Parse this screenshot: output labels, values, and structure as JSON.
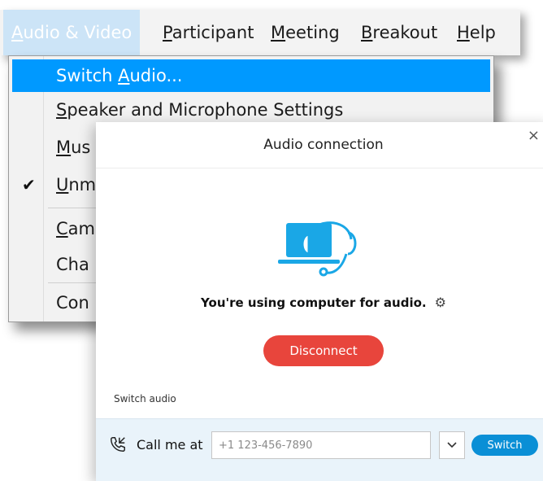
{
  "menubar": {
    "items": [
      {
        "label": "Audio & Video",
        "mnemonic": "A",
        "rest": "udio & Video"
      },
      {
        "label": "Participant",
        "mnemonic": "P",
        "rest": "articipant"
      },
      {
        "label": "Meeting",
        "mnemonic": "M",
        "rest": "eeting"
      },
      {
        "label": "Breakout",
        "mnemonic": "B",
        "rest": "reakout"
      },
      {
        "label": "Help",
        "mnemonic": "H",
        "rest": "elp"
      }
    ]
  },
  "dropdown": {
    "items": [
      {
        "pre": "Switch ",
        "mnemonic": "A",
        "post": "udio..."
      },
      {
        "pre": "",
        "mnemonic": "S",
        "post": "peaker and Microphone Settings"
      },
      {
        "pre": "",
        "mnemonic": "M",
        "post": "us"
      },
      {
        "pre": "",
        "mnemonic": "U",
        "post": "nm"
      },
      {
        "pre": "",
        "mnemonic": "C",
        "post": "am"
      },
      {
        "pre": "",
        "mnemonic": "",
        "post": "Cha"
      },
      {
        "pre": "",
        "mnemonic": "",
        "post": "Con"
      }
    ],
    "check_glyph": "✔"
  },
  "dialog": {
    "title": "Audio connection",
    "close_glyph": "×",
    "status": "You're using computer for audio.",
    "gear_glyph": "⚙",
    "disconnect_label": "Disconnect",
    "switch_audio_label": "Switch audio",
    "call_label": "Call me at",
    "phone_placeholder": "+1 123-456-7890",
    "switch_label": "Switch"
  },
  "colors": {
    "highlight": "#0099ff",
    "disconnect": "#e8453c",
    "switch": "#0a8fd6",
    "illustration": "#1aa7e6"
  }
}
